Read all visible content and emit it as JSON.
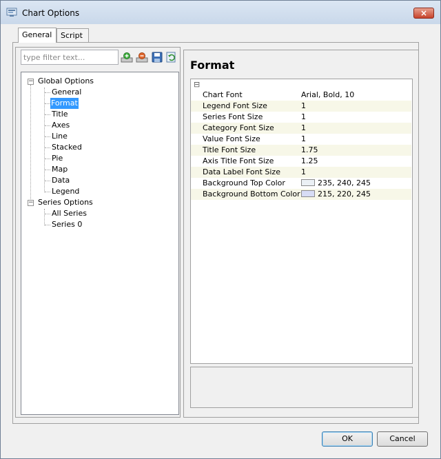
{
  "window": {
    "title": "Chart Options",
    "close_label": "×"
  },
  "tabs": [
    {
      "label": "General",
      "active": true
    },
    {
      "label": "Script",
      "active": false
    }
  ],
  "filter": {
    "placeholder": "type filter text..."
  },
  "toolbar": {
    "buttons": [
      "add-icon",
      "remove-icon",
      "save-icon",
      "refresh-icon"
    ]
  },
  "tree": {
    "global": {
      "label": "Global Options",
      "children": [
        "General",
        "Format",
        "Title",
        "Axes",
        "Line",
        "Stacked",
        "Pie",
        "Map",
        "Data",
        "Legend"
      ]
    },
    "series": {
      "label": "Series Options",
      "children": [
        "All Series",
        "Series 0"
      ]
    },
    "selected": "Format"
  },
  "panel": {
    "title": "Format",
    "collapse_glyph": "⊟",
    "properties": [
      {
        "name": "Chart Font",
        "value": "Arial, Bold, 10"
      },
      {
        "name": "Legend Font Size",
        "value": "1"
      },
      {
        "name": "Series Font Size",
        "value": "1"
      },
      {
        "name": "Category Font Size",
        "value": "1"
      },
      {
        "name": "Value Font Size",
        "value": "1"
      },
      {
        "name": "Title Font Size",
        "value": "1.75"
      },
      {
        "name": "Axis Title Font Size",
        "value": "1.25"
      },
      {
        "name": "Data Label Font Size",
        "value": "1"
      },
      {
        "name": "Background Top Color",
        "value": "235, 240, 245",
        "swatch": "#ebf0f5"
      },
      {
        "name": "Background Bottom Color",
        "value": "215, 220, 245",
        "swatch": "#d7dcf5"
      }
    ]
  },
  "buttons": {
    "ok": "OK",
    "cancel": "Cancel"
  }
}
